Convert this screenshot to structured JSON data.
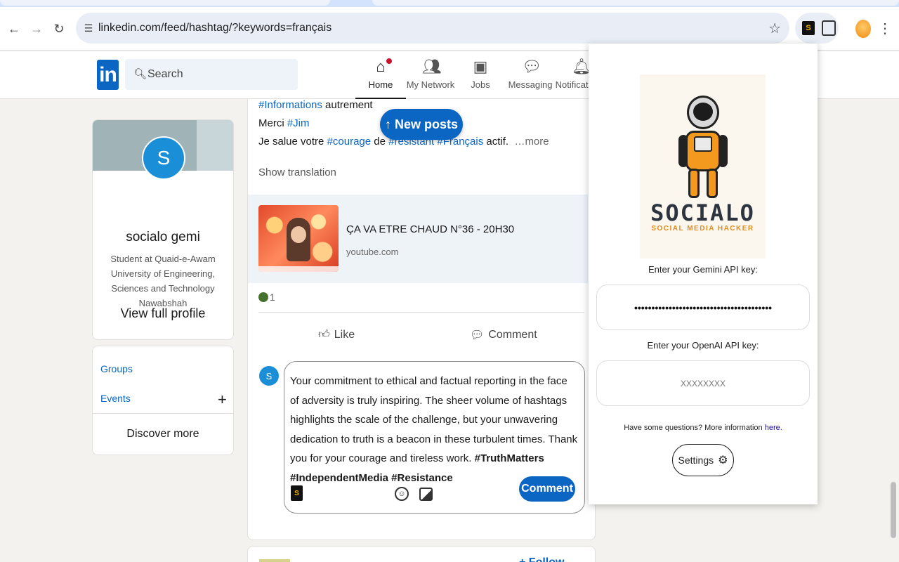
{
  "browser": {
    "url": "linkedin.com/feed/hashtag/?keywords=français",
    "extension_icon_letter": "S",
    "icons": [
      "back-icon",
      "forward-icon",
      "reload-icon",
      "site-info-icon",
      "bookmark-star-icon",
      "extensions-puzzle-icon",
      "profile-avatar-icon",
      "menu-kebab-icon"
    ]
  },
  "linkedin": {
    "logo_text": "in",
    "search_placeholder": "Search",
    "nav": [
      {
        "label": "Home",
        "icon": "home-icon",
        "active": true
      },
      {
        "label": "My Network",
        "icon": "network-icon",
        "active": false
      },
      {
        "label": "Jobs",
        "icon": "briefcase-icon",
        "active": false
      },
      {
        "label": "Messaging",
        "icon": "messaging-icon",
        "active": false
      },
      {
        "label": "Notifications",
        "icon": "bell-icon",
        "active": false
      }
    ],
    "profile": {
      "avatar_letter": "S",
      "name": "socialo gemi",
      "headline": "Student at Quaid-e-Awam University of Engineering, Sciences and Technology Nawabshah",
      "view_profile": "View full profile"
    },
    "sidebar_links": {
      "groups": "Groups",
      "events": "Events",
      "events_plus": "+",
      "discover": "Discover more"
    },
    "new_posts_label": "↑ New posts",
    "post": {
      "line1_tag": "#Informations",
      "line1_rest": " autrement",
      "line2_pre": "Merci ",
      "line2_tag": "#Jim",
      "line3_pre": "Je salue votre ",
      "line3_tag1": "#courage",
      "line3_mid": " de ",
      "line3_tag2": "#résistant",
      "line3_sp": " ",
      "line3_tag3": "#Français",
      "line3_post": " actif.",
      "more": "…more",
      "show_translation": "Show translation",
      "link_title": "ÇA VA ETRE CHAUD N°36 - 20H30",
      "link_source": "youtube.com",
      "reaction_count": "1",
      "like_label": "Like",
      "comment_action_label": "Comment"
    },
    "comment": {
      "avatar_letter": "S",
      "text": "Your commitment to ethical and factual reporting in the face of adversity is truly inspiring.  The sheer volume of hashtags highlights the scale of the challenge, but your unwavering dedication to truth is a beacon in these turbulent times.  Thank you for your courage and tireless work.  ",
      "hashtags": "#TruthMatters #IndependentMedia #Resistance",
      "submit_label": "Comment"
    },
    "next_post_follow": "+ Follow"
  },
  "extension": {
    "brand": "SOCIALO",
    "brand_sub": "SOCIAL MEDIA HACKER",
    "gemini_label": "Enter your Gemini API key:",
    "gemini_value": "••••••••••••••••••••••••••••••••••••••••",
    "openai_label": "Enter your OpenAI API key:",
    "openai_placeholder": "XXXXXXXX",
    "help_text": "Have some questions? More information ",
    "help_link": "here.",
    "settings_label": "Settings"
  },
  "colors": {
    "linkedin_blue": "#0a66c2",
    "brand_orange": "#e38b1c",
    "avatar_blue": "#1a8fd8"
  }
}
